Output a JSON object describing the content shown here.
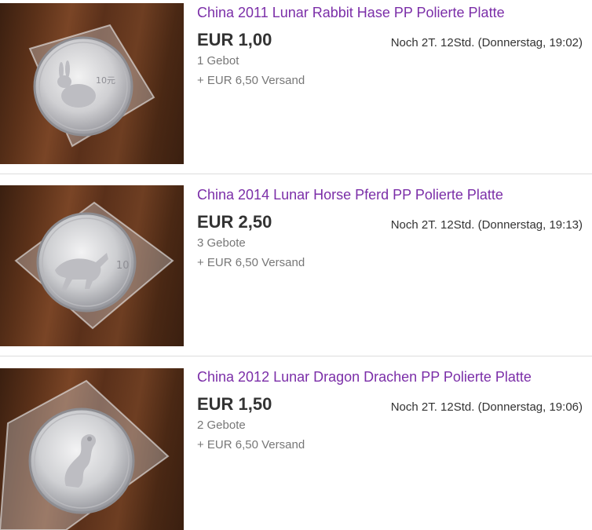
{
  "listings": [
    {
      "title": "China 2011 Lunar Rabbit Hase PP Polierte Platte",
      "price": "EUR 1,00",
      "bids": "1 Gebot",
      "shipping": "+ EUR 6,50 Versand",
      "time_left": "Noch 2T. 12Std. (Donnerstag, 19:02)",
      "image_subject": "rabbit-coin",
      "coin_denomination": "10元"
    },
    {
      "title": "China 2014 Lunar Horse Pferd PP Polierte Platte",
      "price": "EUR 2,50",
      "bids": "3 Gebote",
      "shipping": "+ EUR 6,50 Versand",
      "time_left": "Noch 2T. 12Std. (Donnerstag, 19:13)",
      "image_subject": "horse-coin",
      "coin_denomination": "10"
    },
    {
      "title": "China 2012 Lunar Dragon Drachen PP Polierte Platte",
      "price": "EUR 1,50",
      "bids": "2 Gebote",
      "shipping": "+ EUR 6,50 Versand",
      "time_left": "Noch 2T. 12Std. (Donnerstag, 19:06)",
      "image_subject": "dragon-coin"
    }
  ],
  "colors": {
    "title_link": "#7b2ea8",
    "price": "#333333",
    "secondary_text": "#777777",
    "divider": "#dddddd"
  }
}
